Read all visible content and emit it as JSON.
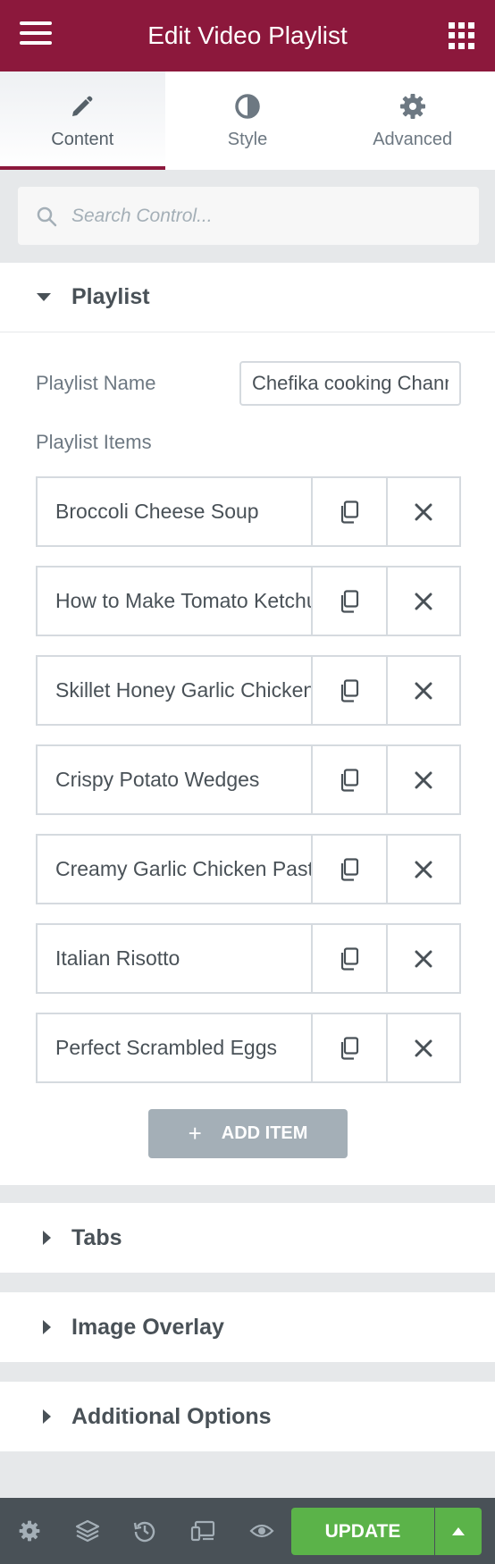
{
  "header": {
    "title": "Edit Video Playlist",
    "menu_icon": "hamburger-menu-icon",
    "apps_icon": "grid-apps-icon"
  },
  "tabs": [
    {
      "label": "Content",
      "icon": "pencil-icon",
      "active": true
    },
    {
      "label": "Style",
      "icon": "contrast-icon",
      "active": false
    },
    {
      "label": "Advanced",
      "icon": "gear-icon",
      "active": false
    }
  ],
  "search": {
    "placeholder": "Search Control..."
  },
  "playlist_section": {
    "title": "Playlist",
    "name_label": "Playlist Name",
    "name_value": "Chefika cooking Channel",
    "items_label": "Playlist Items",
    "items": [
      {
        "title": "Broccoli Cheese Soup"
      },
      {
        "title": "How to Make Tomato Ketchup"
      },
      {
        "title": "Skillet Honey Garlic Chicken"
      },
      {
        "title": "Crispy Potato Wedges"
      },
      {
        "title": "Creamy Garlic Chicken Pasta"
      },
      {
        "title": "Italian Risotto"
      },
      {
        "title": "Perfect Scrambled Eggs"
      }
    ],
    "add_item_icon": "+",
    "add_item_label": "ADD ITEM"
  },
  "collapsed_sections": [
    {
      "title": "Tabs"
    },
    {
      "title": "Image Overlay"
    },
    {
      "title": "Additional Options"
    }
  ],
  "footer": {
    "update_label": "UPDATE",
    "icons": [
      "settings-icon",
      "layers-icon",
      "history-icon",
      "responsive-icon",
      "preview-eye-icon"
    ]
  },
  "colors": {
    "brand": "#8c183c",
    "update": "#5bb349",
    "footer": "#495157",
    "panel_bg": "#e6e8ea"
  }
}
